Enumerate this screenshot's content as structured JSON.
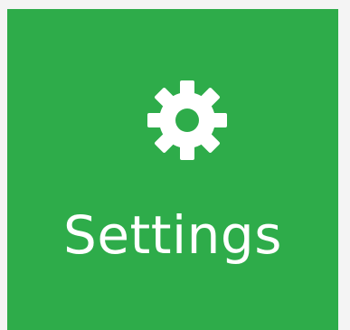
{
  "tile": {
    "label": "Settings",
    "icon": "gear-icon",
    "background_color": "#2eac4a",
    "text_color": "#ffffff"
  }
}
